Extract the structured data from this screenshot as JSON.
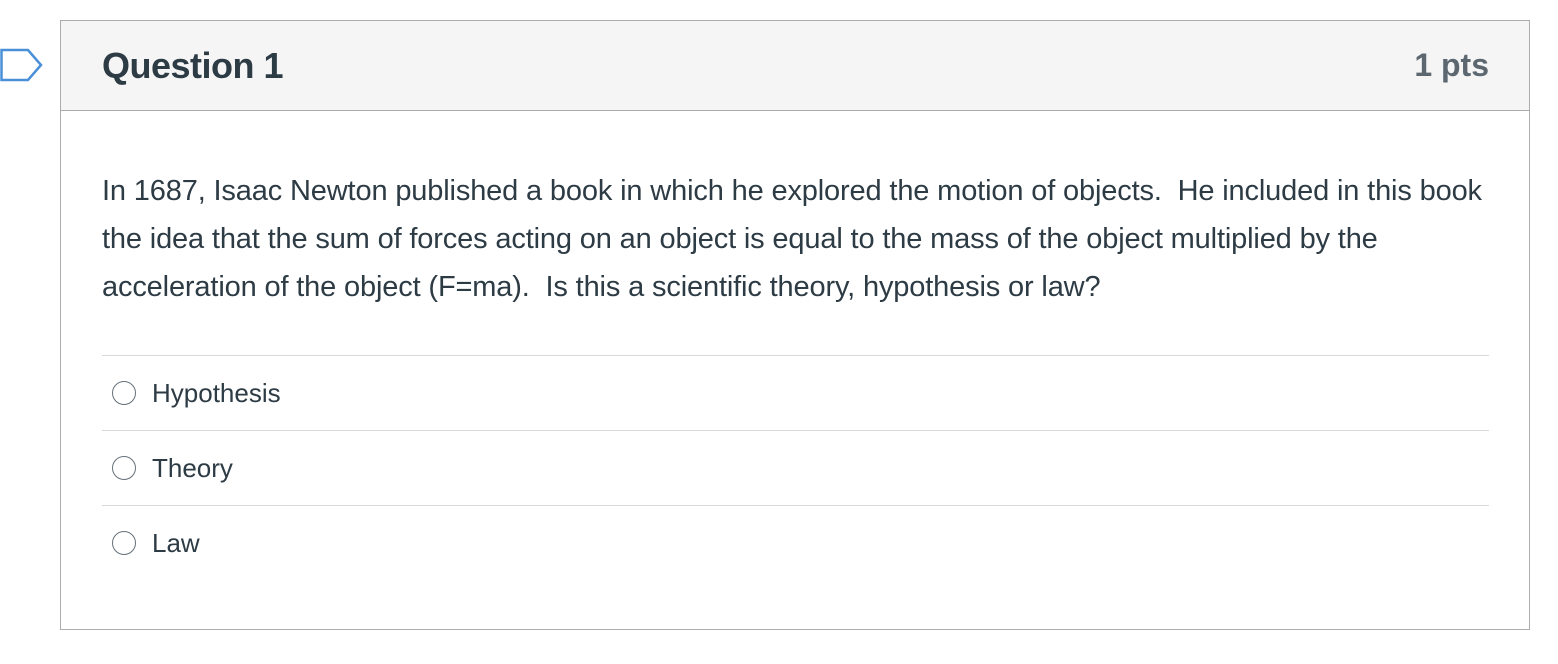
{
  "question": {
    "title": "Question 1",
    "points": "1 pts",
    "text": "In 1687, Isaac Newton published a book in which he explored the motion of objects.  He included in this book the idea that the sum of forces acting on an object is equal to the mass of the object multiplied by the acceleration of the object (F=ma).  Is this a scientific theory, hypothesis or law?",
    "answers": [
      {
        "label": "Hypothesis",
        "selected": false
      },
      {
        "label": "Theory",
        "selected": false
      },
      {
        "label": "Law",
        "selected": false
      }
    ]
  },
  "icons": {
    "flag": "flag-outline-icon"
  },
  "colors": {
    "header_bg": "#f5f5f5",
    "border": "#a9adb0",
    "text": "#2d3b45",
    "points_text": "#5c6770",
    "flag_stroke": "#4a90d9"
  }
}
